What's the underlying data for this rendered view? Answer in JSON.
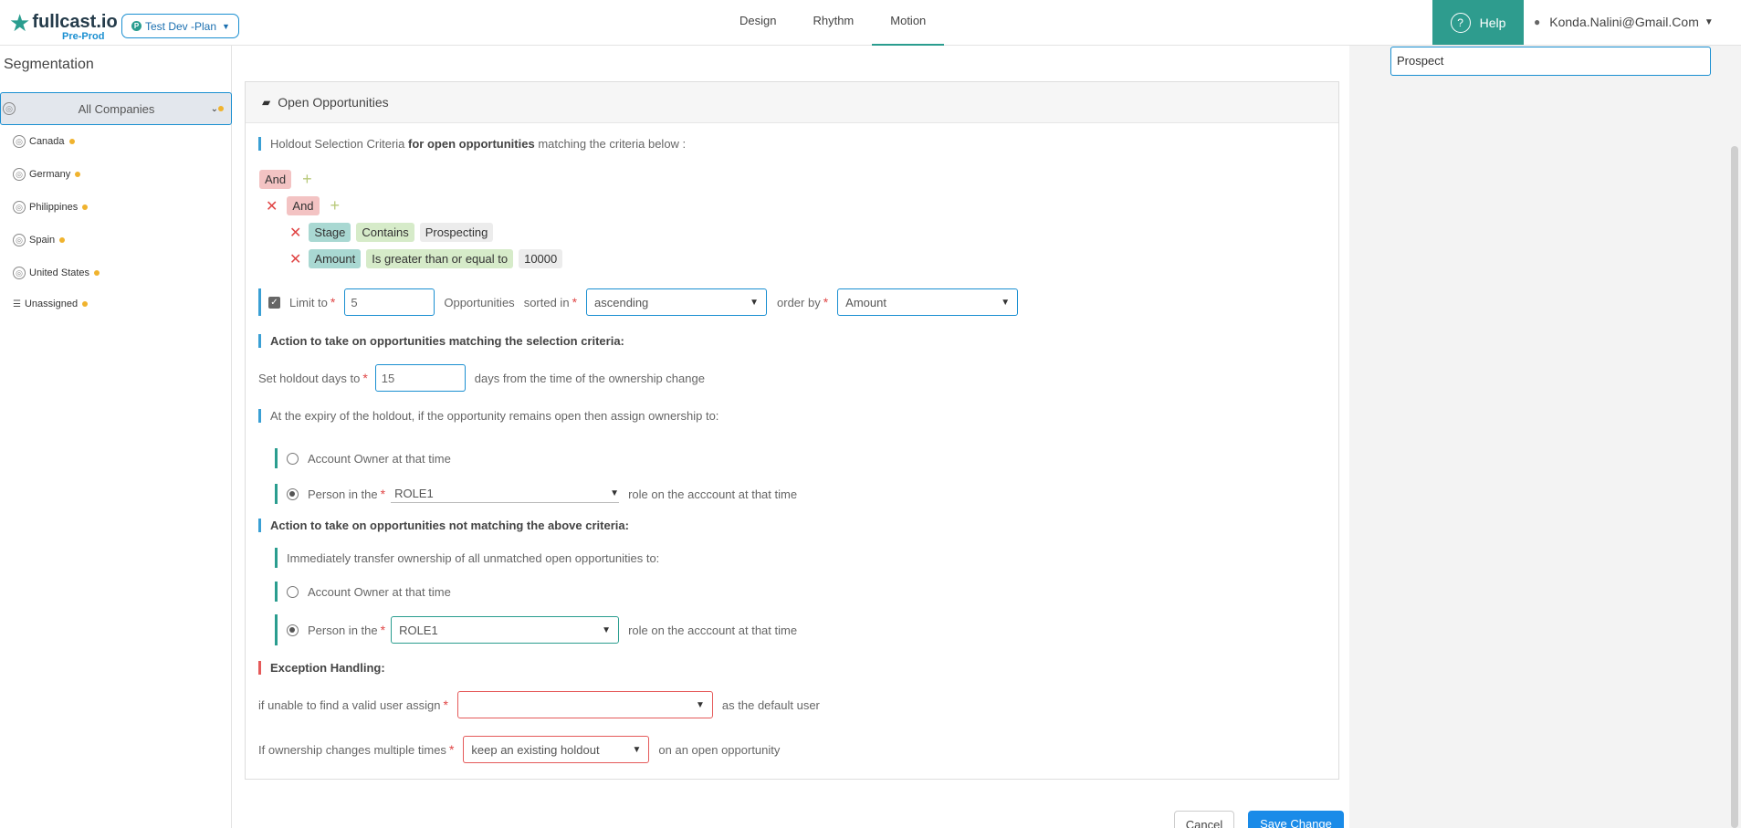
{
  "header": {
    "logo_text": "fullcast.io",
    "logo_sub": "Pre-Prod",
    "plan_badge": "P",
    "plan": "Test Dev -Plan",
    "tabs": [
      "Design",
      "Rhythm",
      "Motion"
    ],
    "active_tab": "Motion",
    "help": "Help",
    "user": "Konda.Nalini@Gmail.Com"
  },
  "sidebar": {
    "title": "Segmentation",
    "items": [
      "All Companies",
      "Canada",
      "Germany",
      "Philippines",
      "Spain",
      "United States",
      "Unassigned"
    ]
  },
  "panel": {
    "title": "Open Opportunities",
    "criteria_prefix": "Holdout Selection Criteria",
    "criteria_bold": "for open opportunities",
    "criteria_suffix": "matching the criteria below :",
    "and": "And",
    "conditions": [
      {
        "field": "Stage",
        "op": "Contains",
        "value": "Prospecting"
      },
      {
        "field": "Amount",
        "op": "Is greater than or equal to",
        "value": "10000"
      }
    ],
    "limit_label": "Limit to",
    "limit_value": "5",
    "opps_label": "Opportunities",
    "sorted_label": "sorted in",
    "sort_value": "ascending",
    "order_label": "order by",
    "order_value": "Amount",
    "action_match": "Action to take on opportunities matching the selection criteria:",
    "holdout_label": "Set holdout days to",
    "holdout_value": "15",
    "holdout_suffix": "days from the time of the ownership change",
    "expiry_text": "At the expiry of the holdout, if the opportunity remains open then assign ownership to:",
    "account_owner": "Account Owner at that time",
    "person_in": "Person in the",
    "role_value": "ROLE1",
    "role_suffix": "role on the acccount at that time",
    "action_nomatch": "Action to take on opportunities not matching the above criteria:",
    "transfer_text": "Immediately transfer ownership of all unmatched open opportunities to:",
    "exception_title": "Exception Handling:",
    "unable_label": "if unable to find a valid user assign",
    "unable_value": "",
    "default_user": "as the default user",
    "multiple_label": "If ownership changes multiple times",
    "multiple_value": "keep an existing holdout",
    "multiple_suffix": "on an open opportunity"
  },
  "actions": {
    "cancel": "Cancel",
    "save": "Save Change"
  },
  "right": {
    "name_value": "Prospect"
  },
  "colors": {
    "accent": "#2a9d8f",
    "primary": "#1a8fd1",
    "error": "#e55a5a"
  }
}
